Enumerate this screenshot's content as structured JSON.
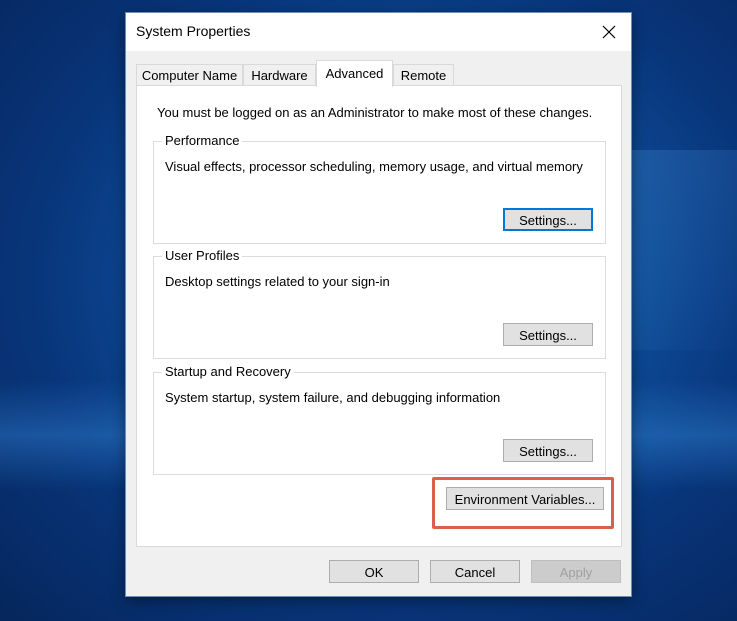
{
  "window": {
    "title": "System Properties"
  },
  "tabs": [
    {
      "label": "Computer Name",
      "active": false
    },
    {
      "label": "Hardware",
      "active": false
    },
    {
      "label": "Advanced",
      "active": true
    },
    {
      "label": "Remote",
      "active": false
    }
  ],
  "advanced": {
    "admin_message": "You must be logged on as an Administrator to make most of these changes.",
    "performance": {
      "title": "Performance",
      "description": "Visual effects, processor scheduling, memory usage, and virtual memory",
      "button": "Settings..."
    },
    "user_profiles": {
      "title": "User Profiles",
      "description": "Desktop settings related to your sign-in",
      "button": "Settings..."
    },
    "startup_recovery": {
      "title": "Startup and Recovery",
      "description": "System startup, system failure, and debugging information",
      "button": "Settings..."
    },
    "env_vars_button": "Environment Variables..."
  },
  "footer": {
    "ok": "OK",
    "cancel": "Cancel",
    "apply": "Apply"
  },
  "colors": {
    "highlight": "#d9614b",
    "focus_border": "#0078d7"
  }
}
